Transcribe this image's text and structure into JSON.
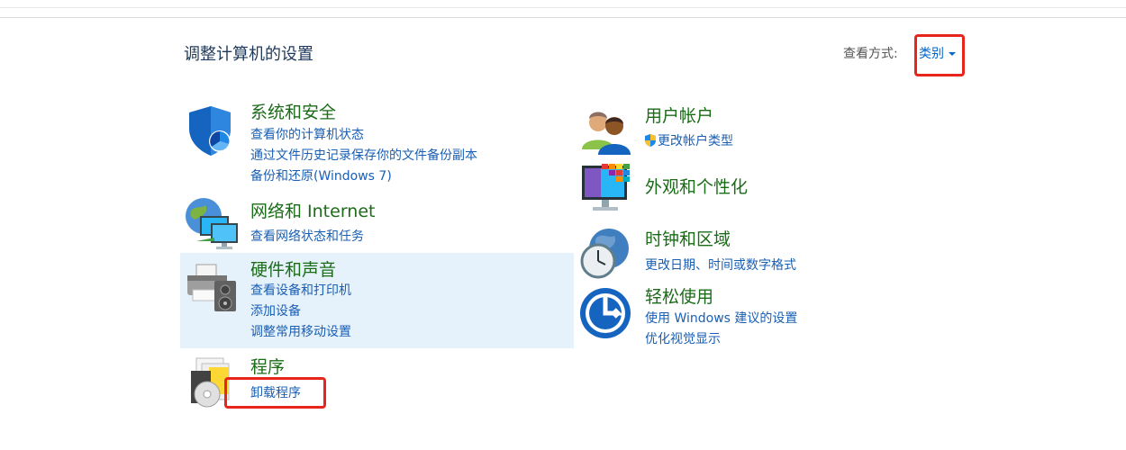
{
  "header": {
    "title": "调整计算机的设置",
    "view_by_label": "查看方式:",
    "view_by_value": "类别"
  },
  "left_categories": [
    {
      "title": "系统和安全",
      "links": [
        "查看你的计算机状态",
        "通过文件历史记录保存你的文件备份副本",
        "备份和还原(Windows 7)"
      ],
      "icon": "shield-icon"
    },
    {
      "title": "网络和 Internet",
      "links": [
        "查看网络状态和任务"
      ],
      "icon": "network-icon"
    },
    {
      "title": "硬件和声音",
      "links": [
        "查看设备和打印机",
        "添加设备",
        "调整常用移动设置"
      ],
      "icon": "printer-icon"
    },
    {
      "title": "程序",
      "links": [
        "卸载程序"
      ],
      "icon": "programs-icon"
    }
  ],
  "right_categories": [
    {
      "title": "用户帐户",
      "links": [
        "更改帐户类型"
      ],
      "icon": "users-icon"
    },
    {
      "title": "外观和个性化",
      "links": [],
      "icon": "monitor-icon"
    },
    {
      "title": "时钟和区域",
      "links": [
        "更改日期、时间或数字格式"
      ],
      "icon": "clock-globe-icon"
    },
    {
      "title": "轻松使用",
      "links": [
        "使用 Windows 建议的设置",
        "优化视觉显示"
      ],
      "icon": "ease-of-access-icon"
    }
  ],
  "colors": {
    "title_green": "#1b6c18",
    "link_blue": "#1a5fb4",
    "highlight_red": "#e8251d",
    "hover_bg": "#e5f1fb"
  }
}
